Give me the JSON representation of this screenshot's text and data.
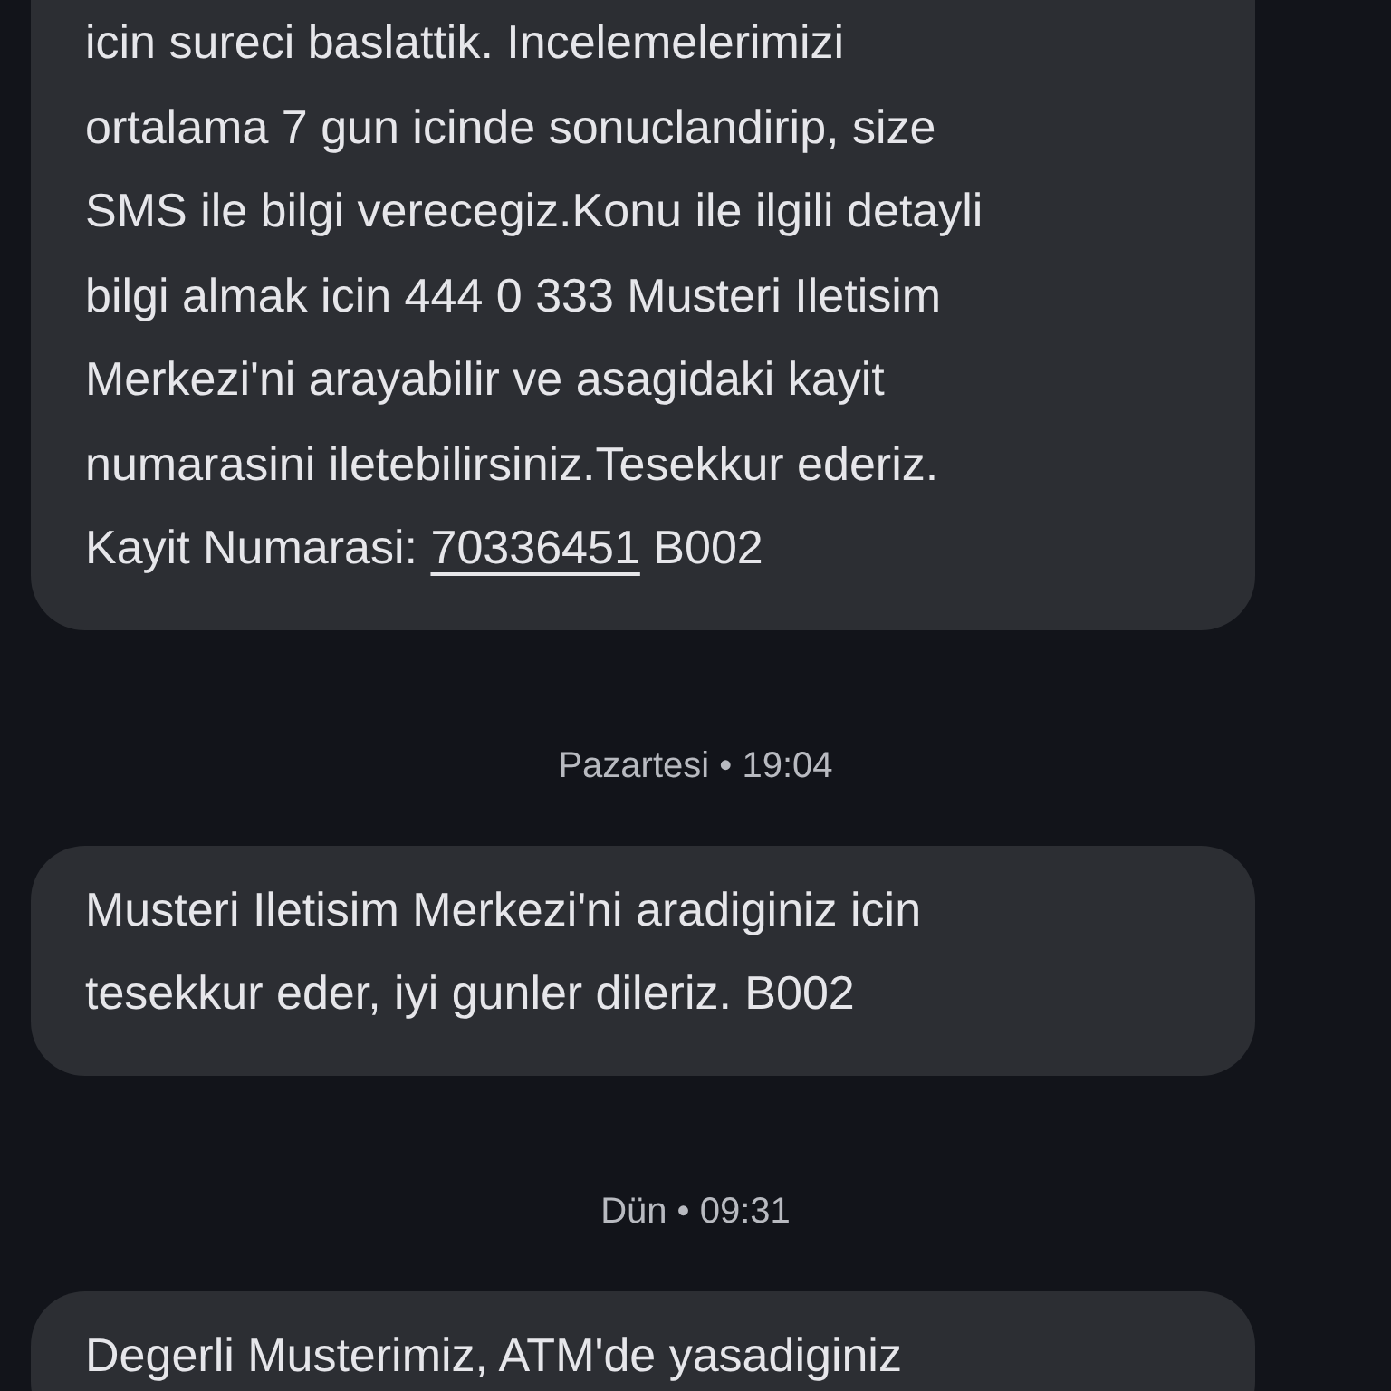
{
  "items": [
    {
      "kind": "message",
      "parts": [
        {
          "text": "icin sureci baslattik. Incelemelerimizi\nortalama 7 gun icinde sonuclandirip, size\nSMS ile bilgi verecegiz.Konu ile ilgili detayli\nbilgi almak icin 444 0 333 Musteri Iletisim\nMerkezi'ni arayabilir ve asagidaki kayit\nnumarasini iletebilirsiniz.Tesekkur ederiz.\nKayit Numarasi: "
        },
        {
          "link": "70336451"
        },
        {
          "text": " B002"
        }
      ]
    },
    {
      "kind": "date",
      "text": "Pazartesi • 19:04"
    },
    {
      "kind": "message",
      "parts": [
        {
          "text": "Musteri Iletisim Merkezi'ni aradiginiz icin\ntesekkur eder, iyi gunler dileriz. B002"
        }
      ]
    },
    {
      "kind": "date",
      "text": "Dün • 09:31"
    },
    {
      "kind": "message",
      "parts": [
        {
          "text": "Degerli Musterimiz, ATM'de yasadiginiz"
        }
      ]
    }
  ]
}
